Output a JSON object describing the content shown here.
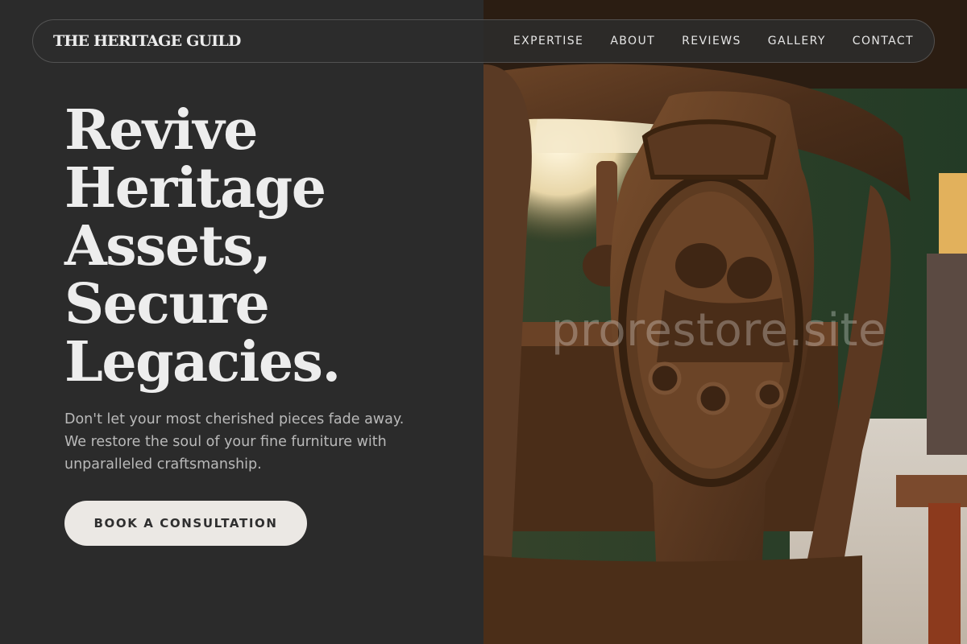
{
  "header": {
    "brand": "THE HERITAGE GUILD",
    "nav": [
      "EXPERTISE",
      "ABOUT",
      "REVIEWS",
      "GALLERY",
      "CONTACT"
    ]
  },
  "hero": {
    "headline": [
      "Revive",
      "Heritage",
      "Assets,",
      "Secure",
      "Legacies."
    ],
    "subtitle": "Don't let your most cherished pieces fade away. We restore the soul of your fine furniture with unparalleled craftsmanship.",
    "cta_label": "BOOK A CONSULTATION"
  },
  "image": {
    "subject": "carved wooden chair back",
    "watermark": "prorestore.site"
  },
  "colors": {
    "background": "#2b2b2b",
    "text": "#ededed",
    "subtext": "#b9b9b9",
    "cta_bg": "#ebe8e4",
    "cta_text": "#2f2f2f"
  }
}
